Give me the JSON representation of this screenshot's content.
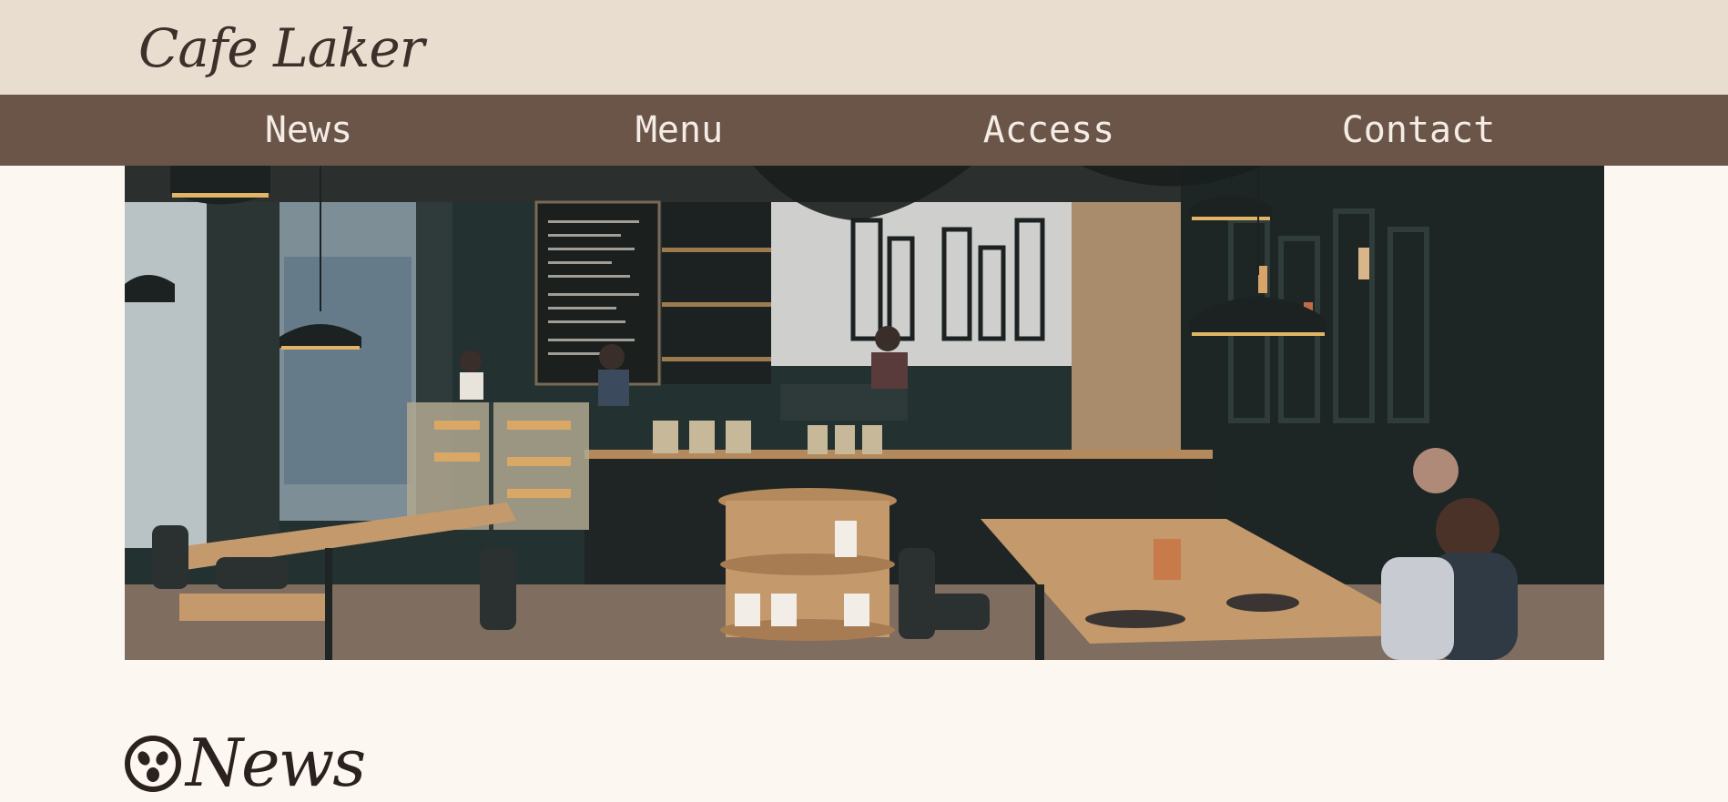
{
  "header": {
    "logo_text": "Cafe Laker"
  },
  "nav": {
    "items": [
      {
        "label": "News"
      },
      {
        "label": "Menu"
      },
      {
        "label": "Access"
      },
      {
        "label": "Contact"
      }
    ]
  },
  "hero": {
    "icon": "cafe-interior-image"
  },
  "news_section": {
    "title": "News",
    "icon": "coffee-bean-icon"
  },
  "colors": {
    "header_bg": "#e9ddd0",
    "nav_bg": "#6a5548",
    "nav_text": "#f4ece5",
    "page_bg": "#fdf7f2",
    "title_text": "#2b2220"
  }
}
